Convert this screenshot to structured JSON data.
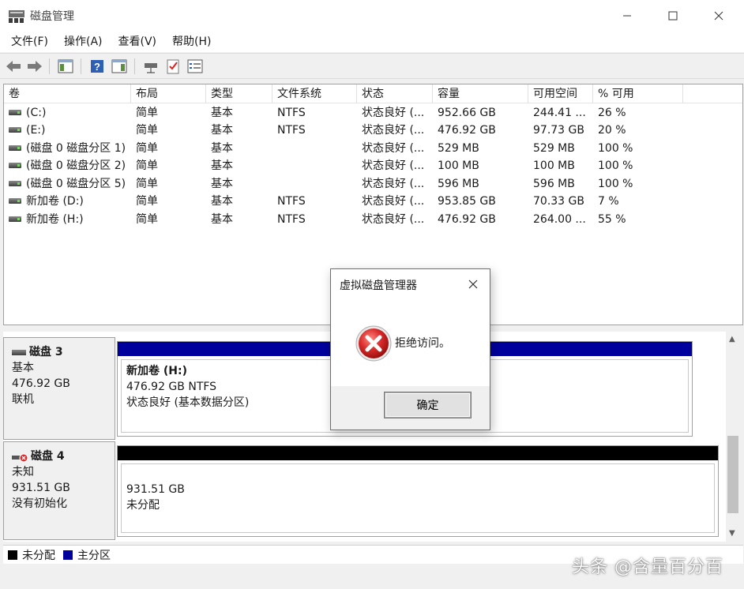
{
  "window": {
    "title": "磁盘管理"
  },
  "menu": [
    "文件(F)",
    "操作(A)",
    "查看(V)",
    "帮助(H)"
  ],
  "columns": [
    "卷",
    "布局",
    "类型",
    "文件系统",
    "状态",
    "容量",
    "可用空间",
    "% 可用"
  ],
  "volumes": [
    [
      "(C:)",
      "简单",
      "基本",
      "NTFS",
      "状态良好 (...",
      "952.66 GB",
      "244.41 ...",
      "26 %"
    ],
    [
      "(E:)",
      "简单",
      "基本",
      "NTFS",
      "状态良好 (...",
      "476.92 GB",
      "97.73 GB",
      "20 %"
    ],
    [
      "(磁盘 0 磁盘分区 1)",
      "简单",
      "基本",
      "",
      "状态良好 (...",
      "529 MB",
      "529 MB",
      "100 %"
    ],
    [
      "(磁盘 0 磁盘分区 2)",
      "简单",
      "基本",
      "",
      "状态良好 (...",
      "100 MB",
      "100 MB",
      "100 %"
    ],
    [
      "(磁盘 0 磁盘分区 5)",
      "简单",
      "基本",
      "",
      "状态良好 (...",
      "596 MB",
      "596 MB",
      "100 %"
    ],
    [
      "新加卷 (D:)",
      "简单",
      "基本",
      "NTFS",
      "状态良好 (...",
      "953.85 GB",
      "70.33 GB",
      "7 %"
    ],
    [
      "新加卷 (H:)",
      "简单",
      "基本",
      "NTFS",
      "状态良好 (...",
      "476.92 GB",
      "264.00 ...",
      "55 %"
    ]
  ],
  "disks": [
    {
      "name": "磁盘 3",
      "type": "基本",
      "size": "476.92 GB",
      "state": "联机",
      "partition": {
        "name": "新加卷  (H:)",
        "size_fs": "476.92 GB NTFS",
        "status": "状态良好 (基本数据分区)",
        "bar_color": "#00009c"
      }
    },
    {
      "name": "磁盘 4",
      "type": "未知",
      "size": "931.51 GB",
      "state": "没有初始化",
      "partition": {
        "size": "931.51 GB",
        "status": "未分配",
        "bar_color": "#000000"
      }
    }
  ],
  "legend": [
    {
      "label": "未分配",
      "color": "#000000"
    },
    {
      "label": "主分区",
      "color": "#00009c"
    }
  ],
  "dialog": {
    "title": "虚拟磁盘管理器",
    "message": "拒绝访问。",
    "ok_label": "确定",
    "icon": "error-icon",
    "error_color": "#d92b2b"
  },
  "watermark": "头条 @含量百分百"
}
